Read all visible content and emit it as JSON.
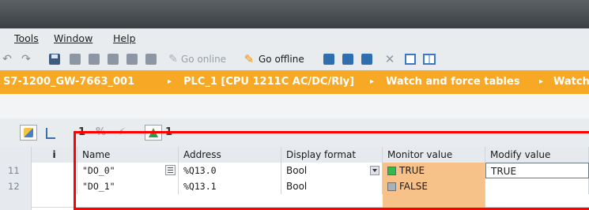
{
  "menubar": {
    "items": [
      {
        "label": "Tools"
      },
      {
        "label": "Window"
      },
      {
        "label": "Help"
      }
    ]
  },
  "toolbar": {
    "go_online": "Go online",
    "go_offline": "Go offline"
  },
  "breadcrumb": {
    "parts": [
      "S7-1200_GW-7663_001",
      "PLC_1 [CPU 1211C AC/DC/Rly]",
      "Watch and force tables",
      "Watch"
    ],
    "separator": "▸"
  },
  "table_toolbar": {
    "glyphs": [
      "1",
      "%",
      "1"
    ]
  },
  "table": {
    "columns": [
      "",
      "i",
      "Name",
      "Address",
      "Display format",
      "Monitor value",
      "Modify value"
    ],
    "rows": [
      {
        "num": "11",
        "name": "\"DO_0\"",
        "address": "%Q13.0",
        "format": "Bool",
        "monitor": "TRUE",
        "monitor_state": "true",
        "modify": "TRUE"
      },
      {
        "num": "12",
        "name": "\"DO_1\"",
        "address": "%Q13.1",
        "format": "Bool",
        "monitor": "FALSE",
        "monitor_state": "false",
        "modify": ""
      }
    ]
  },
  "colors": {
    "breadcrumb_bg": "#f7a824",
    "monitor_bg": "#f6c28a",
    "highlight": "#ff0000",
    "true_indicator": "#2fbd4a",
    "false_indicator": "#a9b0b7"
  }
}
